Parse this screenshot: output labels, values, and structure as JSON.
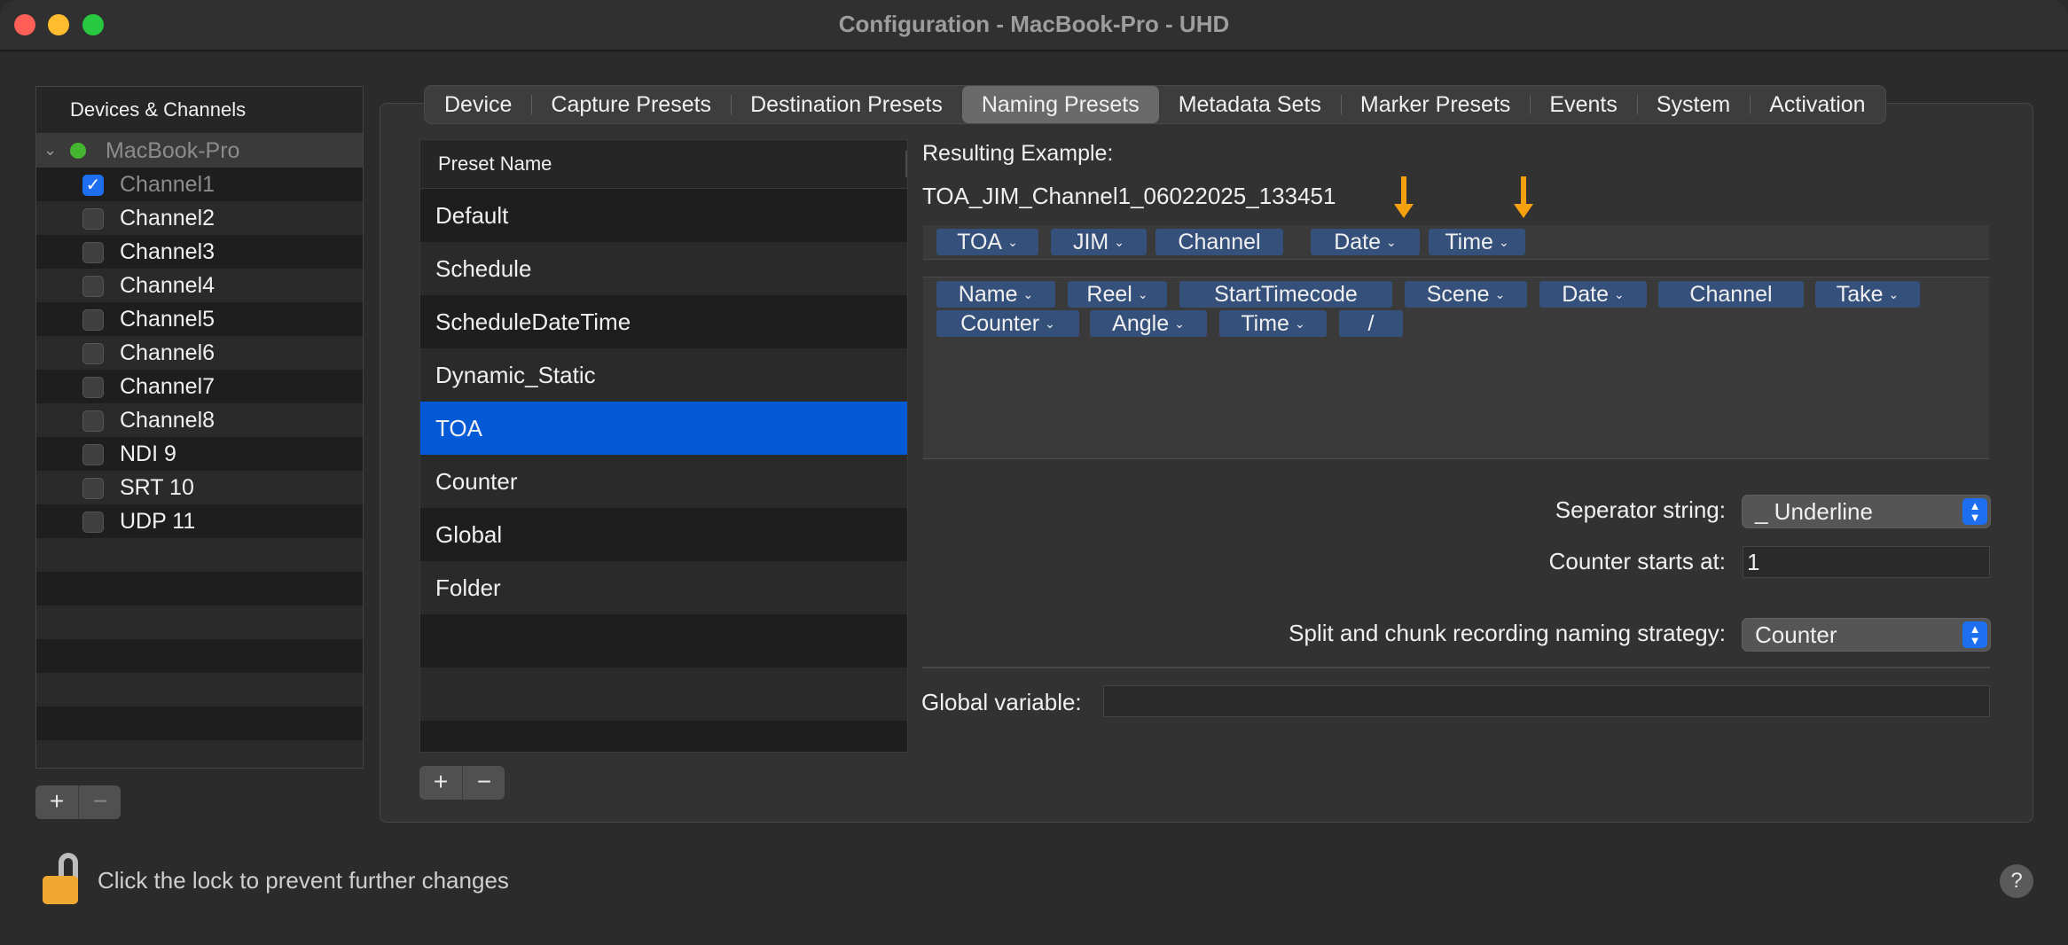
{
  "window": {
    "title": "Configuration - MacBook-Pro - UHD"
  },
  "sidebar": {
    "header": "Devices & Channels",
    "device": "MacBook-Pro",
    "channels": [
      {
        "label": "Channel1",
        "checked": true
      },
      {
        "label": "Channel2",
        "checked": false
      },
      {
        "label": "Channel3",
        "checked": false
      },
      {
        "label": "Channel4",
        "checked": false
      },
      {
        "label": "Channel5",
        "checked": false
      },
      {
        "label": "Channel6",
        "checked": false
      },
      {
        "label": "Channel7",
        "checked": false
      },
      {
        "label": "Channel8",
        "checked": false
      },
      {
        "label": "NDI 9",
        "checked": false
      },
      {
        "label": "SRT 10",
        "checked": false
      },
      {
        "label": "UDP 11",
        "checked": false
      }
    ],
    "add_label": "+",
    "remove_label": "−"
  },
  "tabs": [
    "Device",
    "Capture Presets",
    "Destination Presets",
    "Naming Presets",
    "Metadata Sets",
    "Marker Presets",
    "Events",
    "System",
    "Activation"
  ],
  "active_tab": "Naming Presets",
  "presets": {
    "header": "Preset Name",
    "items": [
      "Default",
      "Schedule",
      "ScheduleDateTime",
      "Dynamic_Static",
      "TOA",
      "Counter",
      "Global",
      "Folder"
    ],
    "selected": "TOA",
    "add_label": "+",
    "remove_label": "−"
  },
  "result": {
    "label": "Resulting Example:",
    "example": "TOA_JIM_Channel1_06022025_133451"
  },
  "selected_tokens": [
    {
      "label": "TOA",
      "menu": true
    },
    {
      "label": "JIM",
      "menu": true
    },
    {
      "label": "Channel",
      "menu": false
    },
    {
      "label": "Date",
      "menu": true
    },
    {
      "label": "Time",
      "menu": true
    }
  ],
  "available_tokens": [
    {
      "label": "Name",
      "menu": true
    },
    {
      "label": "Reel",
      "menu": true
    },
    {
      "label": "StartTimecode",
      "menu": false
    },
    {
      "label": "Scene",
      "menu": true
    },
    {
      "label": "Date",
      "menu": true
    },
    {
      "label": "Channel",
      "menu": false
    },
    {
      "label": "Take",
      "menu": true
    },
    {
      "label": "Counter",
      "menu": true
    },
    {
      "label": "Angle",
      "menu": true
    },
    {
      "label": "Time",
      "menu": true
    },
    {
      "label": "/",
      "menu": false
    }
  ],
  "form": {
    "separator_label": "Seperator string:",
    "separator_value": "_ Underline",
    "counter_label": "Counter starts at:",
    "counter_value": "1",
    "split_label": "Split and chunk recording naming strategy:",
    "split_value": "Counter",
    "global_label": "Global variable:",
    "global_value": ""
  },
  "footer": {
    "lock_text": "Click the lock to prevent further changes",
    "help_label": "?"
  },
  "colors": {
    "selection": "#0459d6",
    "token": "#35507a",
    "arrow": "#f5a00f",
    "accent": "#1d6ff0"
  },
  "icons": [
    "lock-open-icon",
    "help-icon",
    "chevron-down-icon",
    "popup-stepper-icon",
    "checkbox-check-icon",
    "arrow-down-icon"
  ]
}
